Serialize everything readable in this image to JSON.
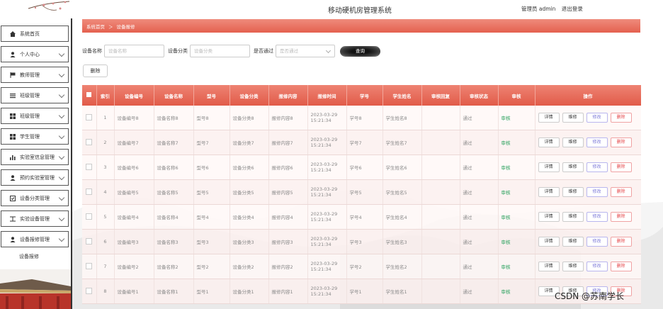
{
  "header": {
    "title": "移动硬机房管理系统",
    "user_label": "管理员 admin",
    "logout": "退出登录"
  },
  "breadcrumb": {
    "home": "系统首页",
    "sep": "＞",
    "current": "设备报修"
  },
  "sidebar": {
    "items": [
      {
        "label": "系统首页",
        "icon": "home-icon",
        "has_arrow": false
      },
      {
        "label": "个人中心",
        "icon": "user-icon",
        "has_arrow": true
      },
      {
        "label": "教师管理",
        "icon": "flag-icon",
        "has_arrow": true
      },
      {
        "label": "班级管理",
        "icon": "list-icon",
        "has_arrow": true
      },
      {
        "label": "班级管理",
        "icon": "grid-icon",
        "has_arrow": true
      },
      {
        "label": "学生管理",
        "icon": "grid-icon",
        "has_arrow": true
      },
      {
        "label": "实验室信息管理",
        "icon": "bar-chart-icon",
        "has_arrow": true
      },
      {
        "label": "预约实验室管理",
        "icon": "user-icon",
        "has_arrow": true
      },
      {
        "label": "设备分类管理",
        "icon": "checklist-icon",
        "has_arrow": true
      },
      {
        "label": "实验设备管理",
        "icon": "split-icon",
        "has_arrow": true
      },
      {
        "label": "设备报修管理",
        "icon": "user-icon",
        "has_arrow": true
      }
    ],
    "sub_item": "设备报修"
  },
  "search": {
    "name_label": "设备名称",
    "name_placeholder": "设备名称",
    "category_label": "设备分类",
    "category_placeholder": "设备分类",
    "passed_label": "是否通过",
    "passed_placeholder": "是否通过",
    "query_button": "查询"
  },
  "delete_button": "删除",
  "table": {
    "columns": [
      "",
      "索引",
      "设备编号",
      "设备名称",
      "型号",
      "设备分类",
      "报修内容",
      "报修时间",
      "学号",
      "学生姓名",
      "审核回复",
      "审核状态",
      "审核",
      "操作"
    ],
    "rows": [
      {
        "idx": "1",
        "code": "设备编号8",
        "name": "设备名称8",
        "model": "型号8",
        "category": "设备分类8",
        "content": "报修内容8",
        "time": "2023-03-29 15:21:34",
        "sid": "学号8",
        "sname": "学生姓名8",
        "reply": "",
        "status": "通过",
        "audit": "审核"
      },
      {
        "idx": "2",
        "code": "设备编号7",
        "name": "设备名称7",
        "model": "型号7",
        "category": "设备分类7",
        "content": "报修内容7",
        "time": "2023-03-29 15:21:34",
        "sid": "学号7",
        "sname": "学生姓名7",
        "reply": "",
        "status": "通过",
        "audit": "审核"
      },
      {
        "idx": "3",
        "code": "设备编号6",
        "name": "设备名称6",
        "model": "型号6",
        "category": "设备分类6",
        "content": "报修内容6",
        "time": "2023-03-29 15:21:34",
        "sid": "学号6",
        "sname": "学生姓名6",
        "reply": "",
        "status": "通过",
        "audit": "审核"
      },
      {
        "idx": "4",
        "code": "设备编号5",
        "name": "设备名称5",
        "model": "型号5",
        "category": "设备分类5",
        "content": "报修内容5",
        "time": "2023-03-29 15:21:34",
        "sid": "学号5",
        "sname": "学生姓名5",
        "reply": "",
        "status": "通过",
        "audit": "审核"
      },
      {
        "idx": "5",
        "code": "设备编号4",
        "name": "设备名称4",
        "model": "型号4",
        "category": "设备分类4",
        "content": "报修内容4",
        "time": "2023-03-29 15:21:34",
        "sid": "学号4",
        "sname": "学生姓名4",
        "reply": "",
        "status": "通过",
        "audit": "审核"
      },
      {
        "idx": "6",
        "code": "设备编号3",
        "name": "设备名称3",
        "model": "型号3",
        "category": "设备分类3",
        "content": "报修内容3",
        "time": "2023-03-29 15:21:34",
        "sid": "学号3",
        "sname": "学生姓名3",
        "reply": "",
        "status": "通过",
        "audit": "审核"
      },
      {
        "idx": "7",
        "code": "设备编号2",
        "name": "设备名称2",
        "model": "型号2",
        "category": "设备分类2",
        "content": "报修内容2",
        "time": "2023-03-29 15:21:34",
        "sid": "学号2",
        "sname": "学生姓名2",
        "reply": "",
        "status": "通过",
        "audit": "审核"
      },
      {
        "idx": "8",
        "code": "设备编号1",
        "name": "设备名称1",
        "model": "型号1",
        "category": "设备分类1",
        "content": "报修内容1",
        "time": "2023-03-29 15:21:34",
        "sid": "学号1",
        "sname": "学生姓名1",
        "reply": "",
        "status": "通过",
        "audit": "审核"
      }
    ],
    "actions": {
      "detail": "详情",
      "repair": "维修",
      "edit": "修改",
      "delete": "删除"
    }
  },
  "watermark": "CSDN @苏南学长",
  "colors": {
    "accent": "#e4614f",
    "pass": "#2ca25f",
    "edit": "#7b78d8",
    "delete": "#e5474a"
  }
}
